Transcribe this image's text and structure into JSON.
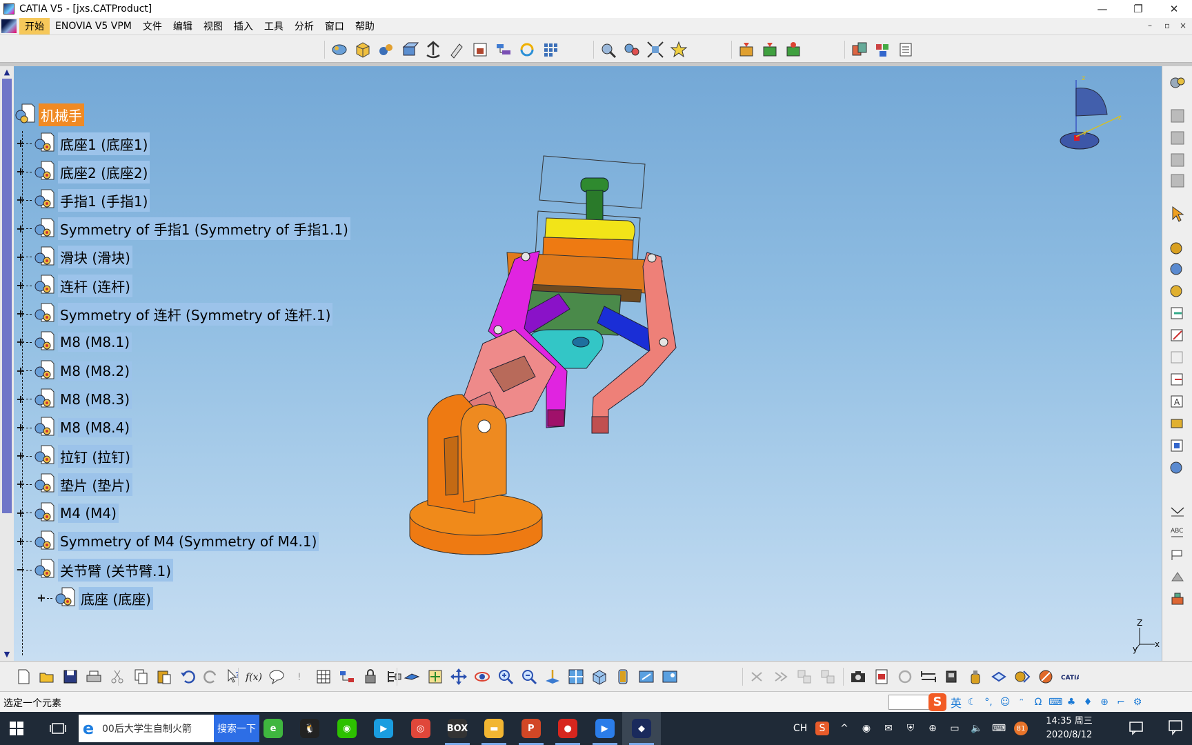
{
  "window": {
    "title": "CATIA V5 - [jxs.CATProduct]",
    "controls": {
      "minimize": "—",
      "restore": "❐",
      "close": "✕"
    },
    "mdi_controls": {
      "minimize": "–",
      "restore": "▫",
      "close": "×"
    }
  },
  "menu": {
    "items": [
      {
        "label": "开始",
        "active": true
      },
      {
        "label": "ENOVIA V5 VPM"
      },
      {
        "label": "文件"
      },
      {
        "label": "编辑"
      },
      {
        "label": "视图"
      },
      {
        "label": "插入"
      },
      {
        "label": "工具"
      },
      {
        "label": "分析"
      },
      {
        "label": "窗口"
      },
      {
        "label": "帮助"
      }
    ]
  },
  "tree": {
    "root": "机械手",
    "nodes": [
      {
        "label": "底座1 (底座1)",
        "expander": "+"
      },
      {
        "label": "底座2 (底座2)",
        "expander": "+"
      },
      {
        "label": "手指1 (手指1)",
        "expander": "+"
      },
      {
        "label": "Symmetry of 手指1 (Symmetry of 手指1.1)",
        "expander": "+"
      },
      {
        "label": "滑块 (滑块)",
        "expander": "+"
      },
      {
        "label": "连杆 (连杆)",
        "expander": "+"
      },
      {
        "label": "Symmetry of 连杆 (Symmetry of 连杆.1)",
        "expander": "+"
      },
      {
        "label": "M8 (M8.1)",
        "expander": "+"
      },
      {
        "label": "M8 (M8.2)",
        "expander": "+"
      },
      {
        "label": "M8 (M8.3)",
        "expander": "+"
      },
      {
        "label": "M8 (M8.4)",
        "expander": "+"
      },
      {
        "label": "拉钉 (拉钉)",
        "expander": "+"
      },
      {
        "label": "垫片 (垫片)",
        "expander": "+"
      },
      {
        "label": "M4 (M4)",
        "expander": "+"
      },
      {
        "label": "Symmetry of M4 (Symmetry of M4.1)",
        "expander": "+"
      },
      {
        "label": "关节臂 (关节臂.1)",
        "expander": "−"
      }
    ],
    "child": {
      "label": "底座 (底座)",
      "expander": "+"
    }
  },
  "axes": {
    "z": "Z",
    "x": "x",
    "y": "y"
  },
  "status": {
    "text": "选定一个元素"
  },
  "ime": {
    "lang": "英"
  },
  "taskbar": {
    "search_query": "00后大学生自制火箭",
    "search_button": "搜索一下",
    "clock_time": "14:35 周三",
    "clock_date": "2020/8/12",
    "tray_lang": "CH",
    "apps": [
      {
        "name": "360-browser-icon",
        "color": "#3fb63f",
        "glyph": "e"
      },
      {
        "name": "qq-icon",
        "color": "#222222",
        "glyph": "🐧"
      },
      {
        "name": "wechat-icon",
        "color": "#2dc100",
        "glyph": "◉"
      },
      {
        "name": "media-player-icon",
        "color": "#1a9de0",
        "glyph": "▶"
      },
      {
        "name": "chrome-icon",
        "color": "#e0473a",
        "glyph": "◎"
      },
      {
        "name": "box-icon",
        "color": "#333333",
        "glyph": "BOX"
      },
      {
        "name": "file-explorer-icon",
        "color": "#f2b632",
        "glyph": "▬"
      },
      {
        "name": "powerpoint-icon",
        "color": "#d24726",
        "glyph": "P"
      },
      {
        "name": "recorder-icon",
        "color": "#d7261e",
        "glyph": "●"
      },
      {
        "name": "video-app-icon",
        "color": "#2b7de9",
        "glyph": "▶"
      },
      {
        "name": "catia-app-icon",
        "color": "#1a2a5c",
        "glyph": "◆"
      }
    ]
  },
  "colors": {
    "viewport_top": "#74a8d6",
    "viewport_bottom": "#c8def2",
    "root_highlight": "#f08a24",
    "menu_active": "#f6c85a"
  }
}
